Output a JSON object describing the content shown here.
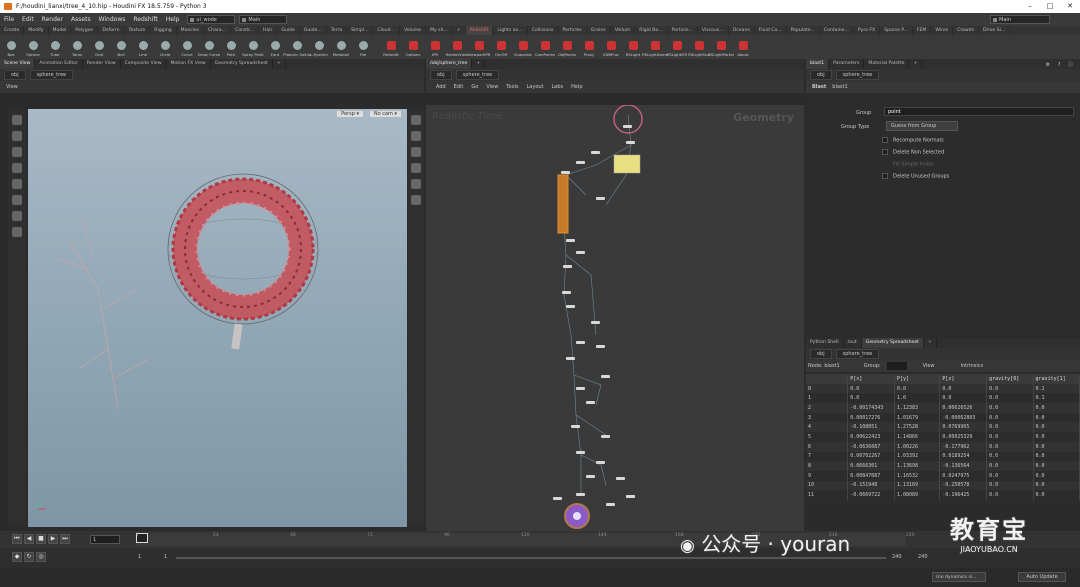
{
  "window": {
    "title": "F:/houdini_lianxi/tree_4_10.hip - Houdini FX 18.5.759 - Python 3",
    "controls": [
      "–",
      "□",
      "✕"
    ]
  },
  "menu": {
    "items": [
      "File",
      "Edit",
      "Render",
      "Assets",
      "Windows",
      "Redshift",
      "Help"
    ],
    "desktop": "ui_wode",
    "desktop2": "Main",
    "right_desktop": "Main"
  },
  "shelf_tabs": [
    "Create",
    "Modify",
    "Model",
    "Polygon",
    "Deform",
    "Texture",
    "Rigging",
    "Muscles",
    "Chara...",
    "Constr...",
    "Hair",
    "Guide",
    "Guide...",
    "Terra",
    "Simpl...",
    "Cloud...",
    "Volume",
    "My sh...",
    "+",
    "Redshift",
    "Lights an...",
    "Collisions",
    "Particles",
    "Grains",
    "Vellum",
    "Rigid Bo...",
    "Particle...",
    "Viscous...",
    "Oceans",
    "Fluid Co...",
    "Populate...",
    "Containe...",
    "Pyro FX",
    "Sparse P...",
    "FEM",
    "Wires",
    "Crowds",
    "Drive Si..."
  ],
  "tools_left": [
    "Box",
    "Sphere",
    "Tube",
    "Torus",
    "Grid",
    "Null",
    "Line",
    "Circle",
    "Curve",
    "Draw Curve",
    "Path",
    "Spray Paint",
    "Font",
    "Platonic Solids",
    "L-System",
    "Metaball",
    "File"
  ],
  "tools_right": [
    "Redshift",
    "Options",
    "IPR",
    "RenderView",
    "ViewportIPR",
    "On/Off",
    "Snapshot",
    "CamParms",
    "ObjParms",
    "Proxy",
    "VDBProc",
    "RSLight",
    "RSLightDome",
    "RSLightIES",
    "RSLightSun",
    "RSLightPortal",
    "About"
  ],
  "left_tabs": [
    "Scene View",
    "Animation Editor",
    "Render View",
    "Composite View",
    "Motion FX View",
    "Geometry Spreadsheet",
    "+"
  ],
  "mid_tabs": [
    "/obj/sphere_tree",
    "+"
  ],
  "right_tabs": [
    "blast1",
    "Parameters",
    "Material Palette",
    "+"
  ],
  "path": {
    "obj": "obj",
    "node": "sphere_tree"
  },
  "viewport": {
    "label": "View",
    "persp": "Persp ▾",
    "cam": "No cam ▾"
  },
  "network": {
    "menu": [
      "Add",
      "Edit",
      "Go",
      "View",
      "Tools",
      "Layout",
      "Labs",
      "Help"
    ],
    "watermark_left": "Realistic Time",
    "watermark_right": "Geometry"
  },
  "params": {
    "node_type": "Blast",
    "node_name": "blast1",
    "group_label": "Group",
    "group_value": "point",
    "group_type_label": "Group Type",
    "group_type_value": "Guess from Group",
    "options": [
      "Recompute Normals",
      "Delete Non Selected",
      "Fill Simple Holes",
      "Delete Unused Groups"
    ]
  },
  "sheet": {
    "tabs": [
      "Python Shell",
      "/out",
      "Geometry Spreadsheet",
      "+"
    ],
    "node_label": "Node: blast1",
    "group_label": "Group:",
    "view_label": "View",
    "intrinsics": "Intrinsics",
    "columns": [
      "",
      "P[x]",
      "P[y]",
      "P[z]",
      "gravity[0]",
      "gravity[1]"
    ],
    "rows": [
      [
        "0",
        "0.0",
        "0.0",
        "0.0",
        "0.0",
        "0.1"
      ],
      [
        "1",
        "0.0",
        "1.0",
        "0.0",
        "0.0",
        "0.1"
      ],
      [
        "2",
        "-0.00174343",
        "1.12383",
        "0.00626526",
        "0.0",
        "0.0"
      ],
      [
        "3",
        "0.00017276",
        "1.01679",
        "-0.00062803",
        "0.0",
        "0.0"
      ],
      [
        "4",
        "-0.108051",
        "1.27528",
        "0.0769965",
        "0.0",
        "0.0"
      ],
      [
        "5",
        "0.00622423",
        "1.14866",
        "0.00025329",
        "0.0",
        "0.0"
      ],
      [
        "6",
        "-0.0636087",
        "1.00226",
        "-0.177962",
        "0.0",
        "0.0"
      ],
      [
        "7",
        "0.00702267",
        "1.03392",
        "0.0189254",
        "0.0",
        "0.0"
      ],
      [
        "8",
        "0.0666301",
        "1.13698",
        "-0.136564",
        "0.0",
        "0.0"
      ],
      [
        "9",
        "0.00847087",
        "1.16532",
        "0.0247975",
        "0.0",
        "0.0"
      ],
      [
        "10",
        "-0.151948",
        "1.13169",
        "-0.250578",
        "0.0",
        "0.0"
      ],
      [
        "11",
        "-0.0669722",
        "1.08089",
        "-0.196425",
        "0.0",
        "0.0"
      ]
    ]
  },
  "timeline": {
    "frame": "1",
    "ticks": [
      "1",
      "24",
      "48",
      "72",
      "96",
      "120",
      "144",
      "168",
      "192",
      "216",
      "240"
    ],
    "start": "1",
    "start2": "1",
    "end": "240",
    "end2": "240",
    "dynamics": "(no dynamics si...",
    "auto_update": "Auto Update"
  },
  "watermark": {
    "text": "公众号 · youran",
    "logo": "教育宝",
    "logo_sub": "JIAOYUBAO.CN"
  },
  "colors": {
    "accent_red": "#d03030",
    "selected_orange": "#e08a2a",
    "viewport_sky": "#9fb2c1"
  }
}
